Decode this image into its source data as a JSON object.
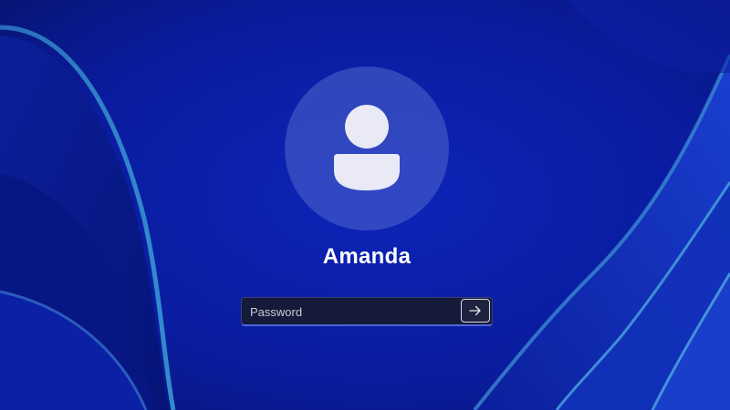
{
  "user": {
    "name": "Amanda"
  },
  "password_field": {
    "placeholder": "Password",
    "value": ""
  },
  "submit": {
    "icon": "arrow-right-icon"
  },
  "avatar": {
    "icon": "user-silhouette-icon"
  },
  "colors": {
    "background": "#0a1c9a",
    "accent_underline": "#4f66d6",
    "field_background": "#15193a",
    "text": "#ffffff"
  }
}
